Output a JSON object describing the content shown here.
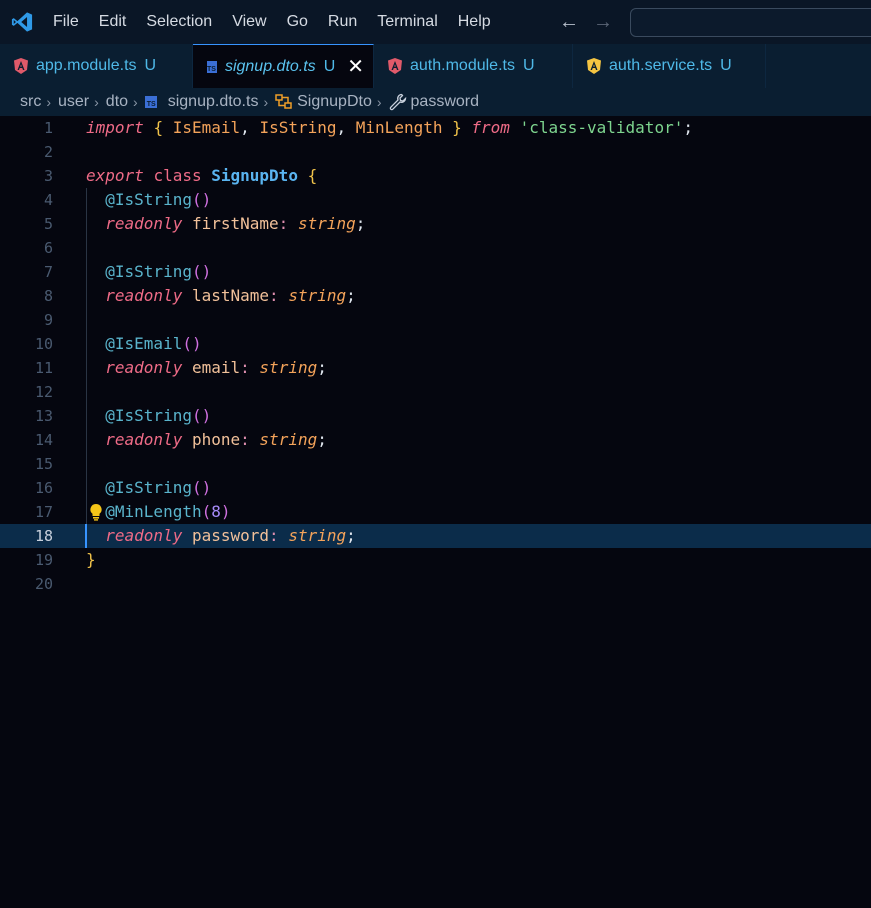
{
  "menu": {
    "items": [
      "File",
      "Edit",
      "Selection",
      "View",
      "Go",
      "Run",
      "Terminal",
      "Help"
    ],
    "back": "←",
    "forward": "→"
  },
  "tabs": [
    {
      "label": "app.module.ts",
      "modified": "U",
      "icon": "angular-icon",
      "active": false
    },
    {
      "label": "signup.dto.ts",
      "modified": "U",
      "icon": "typescript-icon",
      "active": true,
      "close": "✕"
    },
    {
      "label": "auth.module.ts",
      "modified": "U",
      "icon": "angular-icon",
      "active": false
    },
    {
      "label": "auth.service.ts",
      "modified": "U",
      "icon": "angular-service-icon",
      "active": false
    }
  ],
  "breadcrumbs": {
    "src": "src",
    "user": "user",
    "dto": "dto",
    "file": "signup.dto.ts",
    "class": "SignupDto",
    "property": "password",
    "sep": "›"
  },
  "editor": {
    "current_line": 18,
    "line_numbers": [
      "1",
      "2",
      "3",
      "4",
      "5",
      "6",
      "7",
      "8",
      "9",
      "10",
      "11",
      "12",
      "13",
      "14",
      "15",
      "16",
      "17",
      "18",
      "19",
      "20"
    ],
    "tokens": {
      "import": "import",
      "brace_open": "{",
      "IsEmail": "IsEmail",
      "IsString": "IsString",
      "MinLength": "MinLength",
      "brace_close": "}",
      "from": "from",
      "module": "'class-validator'",
      "semi": ";",
      "comma": ",",
      "export": "export",
      "class": "class",
      "SignupDto": "SignupDto",
      "deco_IsString": "@IsString",
      "deco_IsEmail": "@IsEmail",
      "deco_MinLength": "@MinLength",
      "parens": "()",
      "paren_open": "(",
      "paren_close": ")",
      "min_value": "8",
      "readonly": "readonly",
      "firstName": "firstName",
      "lastName": "lastName",
      "email": "email",
      "phone": "phone",
      "password": "password",
      "colon": ":",
      "string": "string"
    }
  },
  "colors": {
    "accent": "#3794ff",
    "keyword": "#ef6b87",
    "string": "#7ed58f",
    "class_name": "#5ab4f0",
    "decorator": "#5ab4cc",
    "lightbulb": "#f5c518"
  }
}
